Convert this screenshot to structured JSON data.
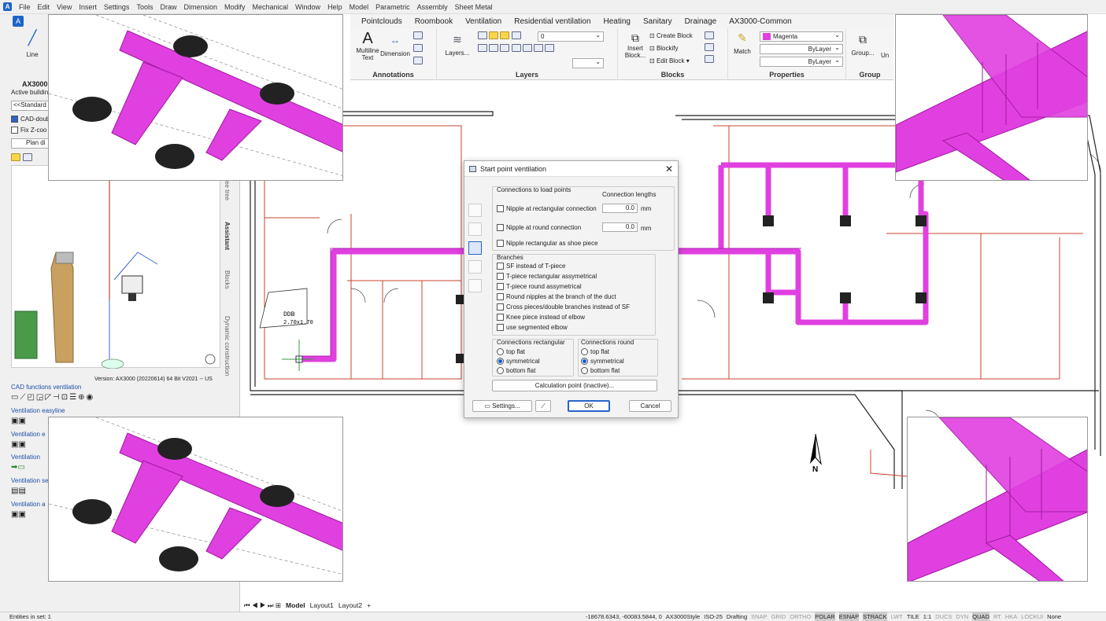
{
  "menu": [
    "File",
    "Edit",
    "View",
    "Insert",
    "Settings",
    "Tools",
    "Draw",
    "Dimension",
    "Modify",
    "Mechanical",
    "Window",
    "Help",
    "Model",
    "Parametric",
    "Assembly",
    "Sheet Metal"
  ],
  "ribbon_tabs": [
    "Pointclouds",
    "Roombook",
    "Ventilation",
    "Residential ventilation",
    "Heating",
    "Sanitary",
    "Drainage",
    "AX3000-Common"
  ],
  "ribbon": {
    "annotations": {
      "label": "Annotations",
      "multiline": "Multiline",
      "text": "Text",
      "dimension": "Dimension"
    },
    "layers": {
      "label": "Layers",
      "layers_btn": "Layers...",
      "layer_value": "0"
    },
    "blocks": {
      "label": "Blocks",
      "insert": "Insert",
      "block": "Block...",
      "create": "Create Block",
      "blockify": "Blockify",
      "edit": "Edit Block"
    },
    "properties": {
      "label": "Properties",
      "match": "Match",
      "color": "Magenta",
      "linetype": "ByLayer",
      "lineweight": "ByLayer"
    },
    "groups": {
      "label": "Group",
      "group_btn": "Group...",
      "ungroup": "Un"
    }
  },
  "left": {
    "line_tool": "Line",
    "app_title": "AX3000",
    "active_building": "Active buildin",
    "standard": "<<Standard",
    "cad_double": "CAD-doub",
    "fix_z": "Fix Z-coo",
    "plan": "Plan di",
    "version": "Version: AX3000 (20220614) 64 Bit V2021  -- US",
    "sections": [
      "CAD functions ventilation",
      "Ventilation easyline",
      "Ventilation e",
      "Ventilation",
      "Ventilation se",
      "Ventilation a"
    ],
    "vtabs": [
      "Assistant",
      "Blocks",
      "Dynamic construction",
      "ee tree"
    ]
  },
  "drawing": {
    "room_label": "DDB",
    "room_size": "2.70x1.70",
    "north": "N"
  },
  "dialog": {
    "title": "Start point ventilation",
    "load_points_label": "Connections to load points",
    "conn_lengths": "Connection lengths",
    "nipple_rect": "Nipple at rectangular connection",
    "nipple_rect_val": "0.0",
    "nipple_round": "Nipple at round connection",
    "nipple_round_val": "0.0",
    "unit": "mm",
    "nipple_shoe": "Nipple rectangular as shoe piece",
    "branches_label": "Branches",
    "branches": [
      "SF instead of T-piece",
      "T-piece rectangular assymetrical",
      "T-piece round assymetrical",
      "Round nipples at the branch of the duct",
      "Cross pieces/double branches instead of SF",
      "Knee piece instead of elbow",
      "use segmented elbow"
    ],
    "conn_rect_label": "Connections rectangular",
    "conn_round_label": "Connections round",
    "rect_options": [
      "top flat",
      "symmetrical",
      "bottom flat"
    ],
    "round_options": [
      "top flat",
      "symmetrical",
      "bottom flat"
    ],
    "calc_point": "Calculation point (inactive)...",
    "settings": "Settings...",
    "ok": "OK",
    "cancel": "Cancel"
  },
  "layout_tabs": [
    "Model",
    "Layout1",
    "Layout2"
  ],
  "status": {
    "left": "Entities in set: 1",
    "coords": "-18678.6343, -60083.5844, 0",
    "style": "AX3000Style",
    "iso": "ISO-25",
    "mode": "Drafting",
    "toggles": [
      "SNAP",
      "GRID",
      "ORTHO",
      "POLAR",
      "ESNAP",
      "STRACK",
      "LWT",
      "TILE",
      "1:1",
      "DUCS",
      "DYN",
      "QUAD",
      "RT",
      "HKA",
      "LOCKUI",
      "None"
    ]
  },
  "colors": {
    "duct": "#e040e0",
    "duct_dark": "#b020b0",
    "wall": "#c8442c",
    "dialog_accent": "#0a5bd6"
  }
}
